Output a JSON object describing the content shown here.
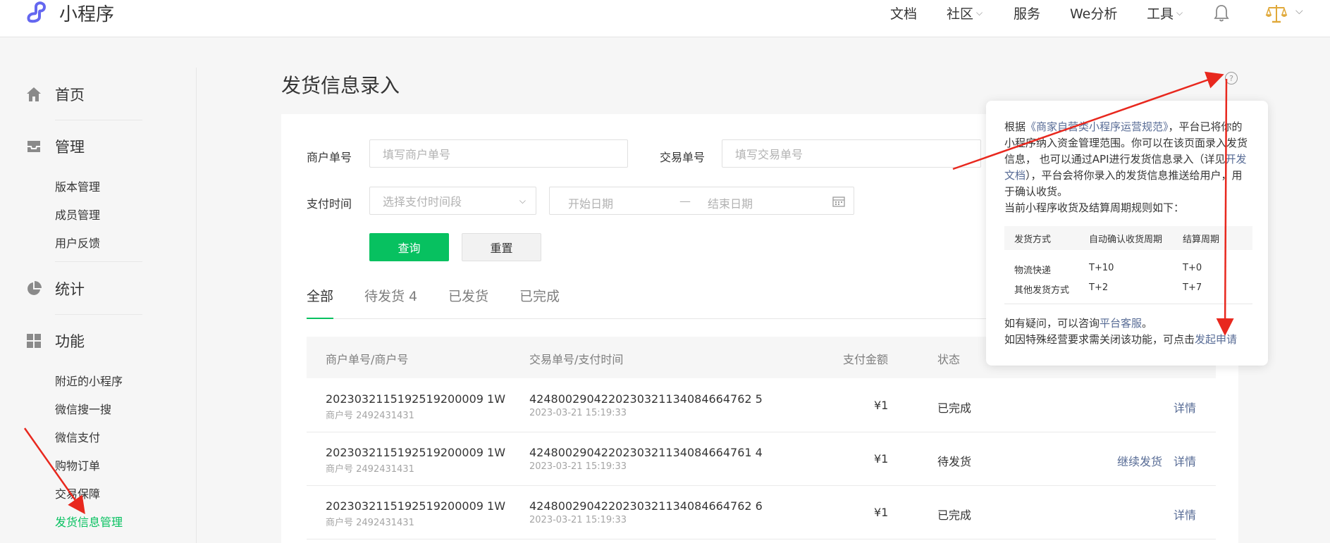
{
  "app": {
    "name": "小程序"
  },
  "topnav": {
    "items": [
      {
        "label": "文档",
        "has_menu": false
      },
      {
        "label": "社区",
        "has_menu": true
      },
      {
        "label": "服务",
        "has_menu": false
      },
      {
        "label": "We分析",
        "has_menu": false
      },
      {
        "label": "工具",
        "has_menu": true
      }
    ]
  },
  "sidebar": {
    "sections": [
      {
        "label": "首页",
        "icon": "home-icon"
      },
      {
        "label": "管理",
        "icon": "inbox-icon"
      },
      {
        "label": "统计",
        "icon": "pie-chart-icon"
      },
      {
        "label": "功能",
        "icon": "grid-icon"
      }
    ],
    "manage_items": [
      "版本管理",
      "成员管理",
      "用户反馈"
    ],
    "feature_items": [
      "附近的小程序",
      "微信搜一搜",
      "微信支付",
      "购物订单",
      "交易保障",
      "发货信息管理"
    ],
    "active_item": "发货信息管理"
  },
  "page": {
    "title": "发货信息录入"
  },
  "filters": {
    "merchant_order_label": "商户单号",
    "merchant_order_placeholder": "填写商户单号",
    "trade_no_label": "交易单号",
    "trade_no_placeholder": "填写交易单号",
    "pay_time_label": "支付时间",
    "pay_time_select_placeholder": "选择支付时间段",
    "start_date_placeholder": "开始日期",
    "range_separator": "—",
    "end_date_placeholder": "结束日期",
    "query_button": "查询",
    "reset_button": "重置"
  },
  "tabs": [
    {
      "label": "全部",
      "active": true
    },
    {
      "label": "待发货 4",
      "active": false
    },
    {
      "label": "已发货",
      "active": false
    },
    {
      "label": "已完成",
      "active": false
    }
  ],
  "table": {
    "headers": [
      "商户单号/商户号",
      "交易单号/支付时间",
      "支付金额",
      "状态"
    ],
    "rows": [
      {
        "order_no": "2023032115192519200009 1W",
        "merchant": "商户号 2492431431",
        "trade_no": "4248002904220230321134084664762 5",
        "pay_time": "2023-03-21 15:19:33",
        "amount": "¥1",
        "status": "已完成",
        "actions": [
          "详情"
        ]
      },
      {
        "order_no": "2023032115192519200009 1W",
        "merchant": "商户号 2492431431",
        "trade_no": "4248002904220230321134084664761 4",
        "pay_time": "2023-03-21 15:19:33",
        "amount": "¥1",
        "status": "待发货",
        "actions": [
          "继续发货",
          "详情"
        ]
      },
      {
        "order_no": "2023032115192519200009 1W",
        "merchant": "商户号 2492431431",
        "trade_no": "4248002904220230321134084664762 6",
        "pay_time": "2023-03-21 15:19:33",
        "amount": "¥1",
        "status": "已完成",
        "actions": [
          "详情"
        ]
      }
    ]
  },
  "popover": {
    "intro_1": "根据",
    "rules_link": "《商家自营类小程序运营规范》",
    "intro_2": "，平台已将你的小程序纳入资金管理范围。你可以在该页面录入发货信息， 也可以通过API进行发货信息录入（详见",
    "dev_doc_link": "开发文档",
    "intro_3": "），平台会将你录入的发货信息推送给用户，用于确认收货。",
    "intro_4": "当前小程序收货及结算周期规则如下：",
    "table_headers": [
      "发货方式",
      "自动确认收货周期",
      "结算周期"
    ],
    "table_rows": [
      [
        "物流快递",
        "T+10",
        "T+0"
      ],
      [
        "其他发货方式",
        "T+2",
        "T+7"
      ]
    ],
    "foot_1": "如有疑问，可以咨询",
    "service_link": "平台客服",
    "foot_1_end": "。",
    "foot_2": "如因特殊经营要求需关闭该功能，可点击",
    "apply_link": "发起申请"
  },
  "colors": {
    "brand_green": "#07c160",
    "link_blue": "#576b95",
    "arrow_red": "#e8281e",
    "logo_purple": "#6467f0"
  }
}
